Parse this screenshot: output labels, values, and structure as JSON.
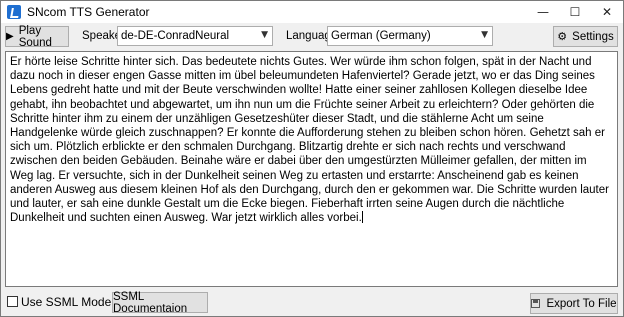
{
  "window": {
    "title": "SNcom TTS Generator",
    "controls": [
      "minimize",
      "maximize",
      "close"
    ]
  },
  "toolbar": {
    "play_label": "Play Sound",
    "speaker_label": "Speaker:",
    "speaker_value": "de-DE-ConradNeural",
    "language_label": "Language:",
    "language_value": "German (Germany)",
    "settings_label": "Settings"
  },
  "editor": {
    "text": "Er hörte leise Schritte hinter sich. Das bedeutete nichts Gutes. Wer würde ihm schon folgen, spät in der Nacht und dazu noch in dieser engen Gasse mitten im übel beleumundeten Hafenviertel? Gerade jetzt, wo er das Ding seines Lebens gedreht hatte und mit der Beute verschwinden wollte! Hatte einer seiner zahllosen Kollegen dieselbe Idee gehabt, ihn beobachtet und abgewartet, um ihn nun um die Früchte seiner Arbeit zu erleichtern? Oder gehörten die Schritte hinter ihm zu einem der unzähligen Gesetzeshüter dieser Stadt, und die stählerne Acht um seine Handgelenke würde gleich zuschnappen? Er konnte die Aufforderung stehen zu bleiben schon hören. Gehetzt sah er sich um. Plötzlich erblickte er den schmalen Durchgang. Blitzartig drehte er sich nach rechts und verschwand zwischen den beiden Gebäuden. Beinahe wäre er dabei über den umgestürzten Mülleimer gefallen, der mitten im Weg lag. Er versuchte, sich in der Dunkelheit seinen Weg zu ertasten und erstarrte: Anscheinend gab es keinen anderen Ausweg aus diesem kleinen Hof als den Durchgang, durch den er gekommen war. Die Schritte wurden lauter und lauter, er sah eine dunkle Gestalt um die Ecke biegen. Fieberhaft irrten seine Augen durch die nächtliche Dunkelheit und suchten einen Ausweg. War jetzt wirklich alles vorbei."
  },
  "footer": {
    "ssml_checkbox_label": "Use SSML Mode",
    "ssml_checked": false,
    "ssml_doc_label": "SSML Documentaion",
    "export_label": "Export To File"
  },
  "icons": {
    "app": "app-icon",
    "play": "play-icon",
    "settings": "gear-icon",
    "export": "save-icon"
  }
}
